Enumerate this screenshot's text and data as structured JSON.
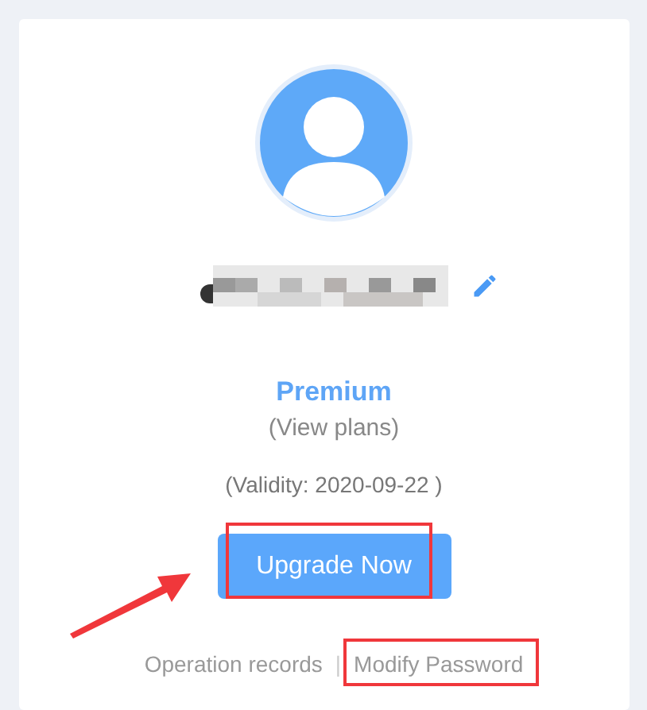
{
  "account": {
    "plan": "Premium",
    "view_plans": "(View plans)",
    "validity": "(Validity: 2020-09-22 )"
  },
  "upgrade_button": "Upgrade Now",
  "links": [
    {
      "label": "Operation records"
    },
    {
      "label": "Modify Password"
    }
  ],
  "separator": "|"
}
